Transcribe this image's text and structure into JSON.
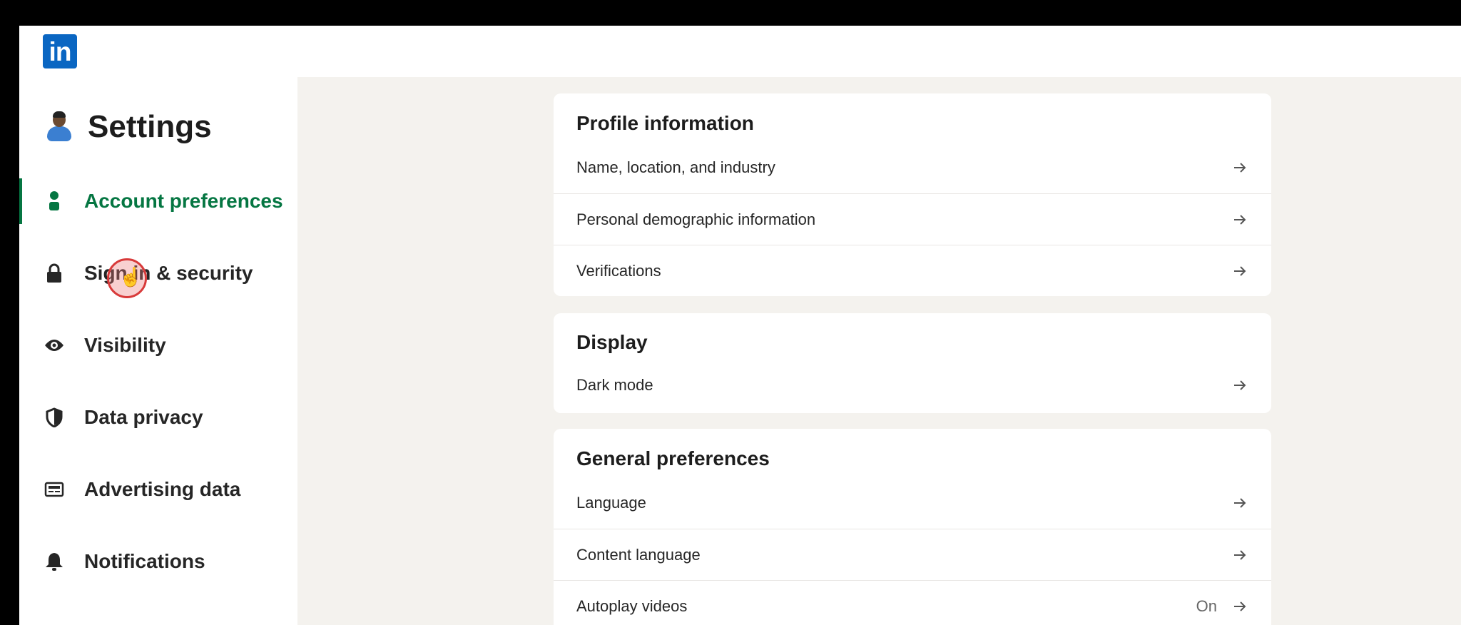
{
  "brand": {
    "logo_text": "in",
    "color": "#0a66c2"
  },
  "settings": {
    "title": "Settings"
  },
  "sidebar": {
    "items": [
      {
        "label": "Account preferences",
        "icon": "person-icon",
        "active": true
      },
      {
        "label": "Sign in & security",
        "icon": "lock-icon"
      },
      {
        "label": "Visibility",
        "icon": "eye-icon"
      },
      {
        "label": "Data privacy",
        "icon": "shield-icon"
      },
      {
        "label": "Advertising data",
        "icon": "newspaper-icon"
      },
      {
        "label": "Notifications",
        "icon": "bell-icon"
      }
    ]
  },
  "main": {
    "profile": {
      "title": "Profile information",
      "rows": [
        {
          "label": "Name, location, and industry"
        },
        {
          "label": "Personal demographic information"
        },
        {
          "label": "Verifications"
        }
      ]
    },
    "display": {
      "title": "Display",
      "rows": [
        {
          "label": "Dark mode"
        }
      ]
    },
    "general": {
      "title": "General preferences",
      "rows": [
        {
          "label": "Language"
        },
        {
          "label": "Content language"
        },
        {
          "label": "Autoplay videos",
          "value": "On"
        }
      ]
    }
  },
  "colors": {
    "active": "#057642",
    "background": "#f4f2ee"
  }
}
